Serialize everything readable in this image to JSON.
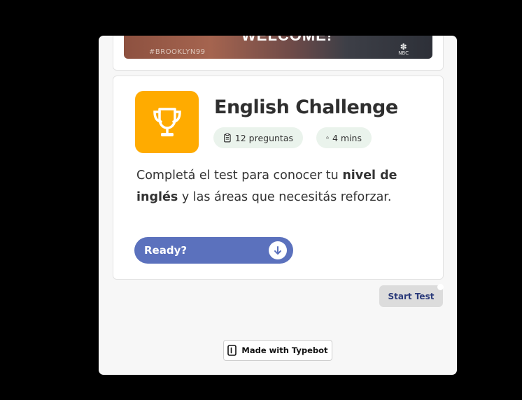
{
  "media": {
    "hashtag": "#BROOKLYN99",
    "overlay_text": "WELCOME!",
    "network": "NBC"
  },
  "card": {
    "title": "English Challenge",
    "chips": {
      "questions": "12 preguntas",
      "time": "4 mins"
    },
    "description": {
      "part1": "Completá el test para conocer tu ",
      "bold1": "nivel de inglés",
      "part2": " y las áreas que necesitás reforzar."
    },
    "ready_label": "Ready?"
  },
  "start_button": "Start Test",
  "footer": {
    "made_with": "Made with Typebot"
  },
  "colors": {
    "accent_orange": "#ffab00",
    "ready_blue": "#5b71bd",
    "chip_green": "#eaf3ec"
  }
}
